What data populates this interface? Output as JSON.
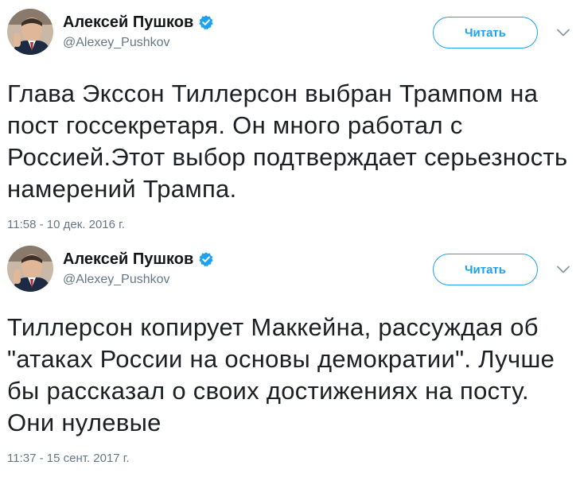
{
  "tweets": [
    {
      "author": {
        "name": "Алексей Пушков",
        "handle": "@Alexey_Pushkov"
      },
      "follow_label": "Читать",
      "text": "Глава Экссон Тиллерсон выбран Трампом на пост госсекретаря. Он много работал с Россией.Этот выбор подтверждает серьезность намерений Трампа.",
      "timestamp": "11:58 - 10 дек. 2016 г."
    },
    {
      "author": {
        "name": "Алексей Пушков",
        "handle": "@Alexey_Pushkov"
      },
      "follow_label": "Читать",
      "text": "Тиллерсон копирует Маккейна, рассуждая об \"атаках России на основы демократии\". Лучше бы рассказал о своих достижениях на посту. Они нулевые",
      "timestamp": "11:37 - 15 сент. 2017 г."
    }
  ],
  "icons": {
    "verified": "verified-badge-icon",
    "menu": "chevron-down-icon"
  },
  "colors": {
    "accent": "#1da1f2",
    "text": "#14171a",
    "secondary": "#657786"
  }
}
